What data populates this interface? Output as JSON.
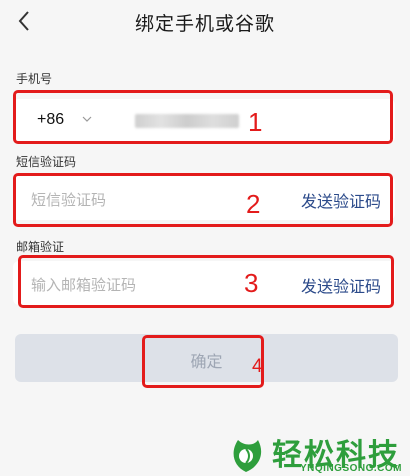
{
  "header": {
    "title": "绑定手机或谷歌",
    "back_icon": "chevron-left-icon"
  },
  "phone": {
    "label": "手机号",
    "country_code": "+86",
    "country_code_icon": "chevron-down-icon",
    "number_masked": true
  },
  "sms": {
    "label": "短信验证码",
    "placeholder": "短信验证码",
    "send_label": "发送验证码"
  },
  "email": {
    "label": "邮箱验证",
    "placeholder": "输入邮箱验证码",
    "send_label": "发送验证码"
  },
  "confirm": {
    "label": "确定"
  },
  "annotations": {
    "box1": "1",
    "box2": "2",
    "box3": "3",
    "box4": "4"
  },
  "watermark": {
    "text": "轻松科技",
    "subtext": "YNQINGSONG.COM"
  },
  "colors": {
    "annotation": "#e31b1b",
    "link": "#2b4a8a",
    "disabled_button": "#dde1e8",
    "watermark": "#2e9e3c"
  }
}
